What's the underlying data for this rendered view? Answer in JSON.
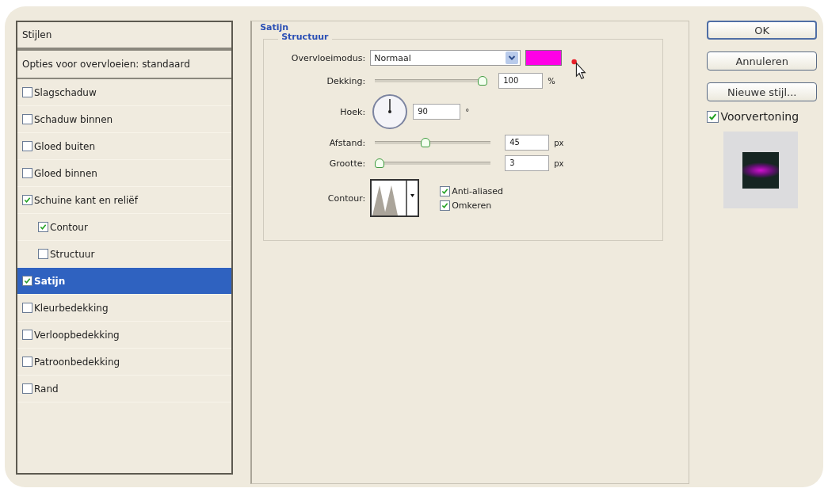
{
  "styles_list": {
    "headers": [
      "Stijlen",
      "Opties voor overvloeien: standaard"
    ],
    "items": [
      {
        "label": "Slagschaduw",
        "checked": false,
        "selected": false
      },
      {
        "label": "Schaduw binnen",
        "checked": false,
        "selected": false
      },
      {
        "label": "Gloed buiten",
        "checked": false,
        "selected": false
      },
      {
        "label": "Gloed binnen",
        "checked": false,
        "selected": false
      },
      {
        "label": "Schuine kant en reliëf",
        "checked": true,
        "selected": false,
        "children": [
          {
            "label": "Contour",
            "checked": true,
            "selected": false
          },
          {
            "label": "Structuur",
            "checked": false,
            "selected": false
          }
        ]
      },
      {
        "label": "Satijn",
        "checked": true,
        "selected": true
      },
      {
        "label": "Kleurbedekking",
        "checked": false,
        "selected": false
      },
      {
        "label": "Verloopbedekking",
        "checked": false,
        "selected": false
      },
      {
        "label": "Patroonbedekking",
        "checked": false,
        "selected": false
      },
      {
        "label": "Rand",
        "checked": false,
        "selected": false
      }
    ]
  },
  "settings": {
    "group_title": "Satijn",
    "subgroup_title": "Structuur",
    "blend_mode": {
      "label": "Overvloeimodus:",
      "value": "Normaal",
      "color": "#ff00e6"
    },
    "opacity": {
      "label": "Dekking:",
      "level": 1.0,
      "value": "100",
      "unit": "%"
    },
    "angle": {
      "label": "Hoek:",
      "value": "90",
      "unit": "°"
    },
    "distance": {
      "label": "Afstand:",
      "level": 0.43,
      "value": "45",
      "unit": "px"
    },
    "size": {
      "label": "Grootte:",
      "level": 0.0,
      "value": "3",
      "unit": "px"
    },
    "contour": {
      "label": "Contour:"
    },
    "options": [
      {
        "label": "Anti-aliased",
        "checked": true
      },
      {
        "label": "Omkeren",
        "checked": true
      }
    ]
  },
  "buttons": [
    {
      "label": "OK",
      "default": true
    },
    {
      "label": "Annuleren",
      "default": false
    },
    {
      "label": "Nieuwe stijl...",
      "default": false
    }
  ],
  "preview": {
    "label": "Voorvertoning",
    "checked": true
  }
}
